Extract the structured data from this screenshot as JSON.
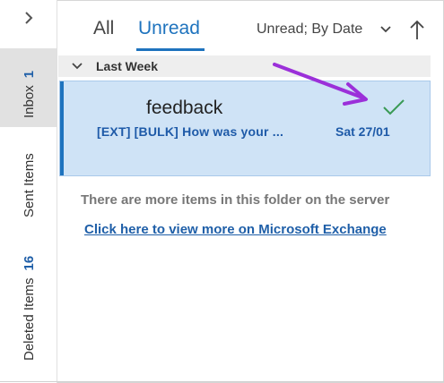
{
  "rail": {
    "expand_icon": "chevron-right-icon",
    "folders": [
      {
        "label": "Inbox",
        "count": "1"
      },
      {
        "label": "Sent Items",
        "count": ""
      },
      {
        "label": "Deleted Items",
        "count": "16"
      }
    ]
  },
  "header": {
    "tabs": [
      {
        "label": "All"
      },
      {
        "label": "Unread"
      }
    ],
    "sort_label": "Unread; By Date",
    "sort_direction_icon": "arrow-up-icon"
  },
  "group": {
    "label": "Last Week"
  },
  "message": {
    "sender": "feedback",
    "subject": "[EXT] [BULK] How was your ...",
    "date": "Sat 27/01",
    "status_icon": "checkmark-icon"
  },
  "notice": {
    "text": "There are more items in this folder on the server",
    "link": "Click here to view more on Microsoft Exchange"
  },
  "colors": {
    "accent": "#1e73be",
    "selected_bg": "#cfe3f6",
    "annotation": "#9b30d9",
    "check": "#3a9a55"
  }
}
